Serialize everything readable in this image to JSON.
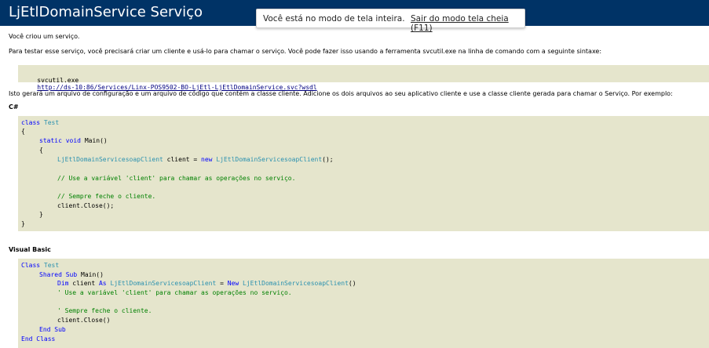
{
  "header": {
    "title": "LjEtlDomainService Serviço"
  },
  "fullscreen_notice": {
    "message": "Você está no modo de tela inteira.",
    "exit_link": "Sair do modo tela cheia (F11)"
  },
  "intro": {
    "created": "Você criou um serviço.",
    "instructions": "Para testar esse serviço, você precisará criar um cliente e usá-lo para chamar o serviço. Você pode fazer isso usando a ferramenta svcutil.exe na linha de comando com a seguinte sintaxe:",
    "svcutil_cmd": "svcutil.exe",
    "svcutil_url": "http://ds-10:86/Services/Linx-POS9502-BO-LjEtl-LjEtlDomainService.svc?wsdl",
    "generate_text": "Isto gerará um arquivo de configuração e um arquivo de código que contém a classe cliente. Adicione os dois arquivos ao seu aplicativo cliente e use a classe cliente gerada para chamar o Serviço. Por exemplo:"
  },
  "csharp": {
    "heading": "C#",
    "kw_class": "class",
    "class_name": "Test",
    "open_brace": "{",
    "kw_static": "static",
    "kw_void": "void",
    "method": "Main()",
    "client_type": "LjEtlDomainServicesoapClient",
    "client_assign": " client = ",
    "kw_new": "new",
    "client_ctor": "LjEtlDomainServicesoapClient",
    "ctor_end": "();",
    "comment_use": "// Use a variável 'client' para chamar as operações no serviço.",
    "comment_close": "// Sempre feche o cliente.",
    "close_call": "client.Close();",
    "close_brace": "}"
  },
  "vb": {
    "heading": "Visual Basic",
    "kw_class": "Class",
    "class_name": "Test",
    "kw_shared_sub": "Shared Sub",
    "method": "Main()",
    "kw_dim": "Dim",
    "dim_client": " client ",
    "kw_as": "As",
    "client_type": "LjEtlDomainServicesoapClient",
    "equals": " = ",
    "kw_new": "New",
    "client_ctor": "LjEtlDomainServicesoapClient",
    "ctor_end": "()",
    "comment_use": "' Use a variável 'client' para chamar as operações no serviço.",
    "comment_close": "' Sempre feche o cliente.",
    "close_call": "client.Close()",
    "end_sub": "End Sub",
    "end_class": "End Class"
  }
}
